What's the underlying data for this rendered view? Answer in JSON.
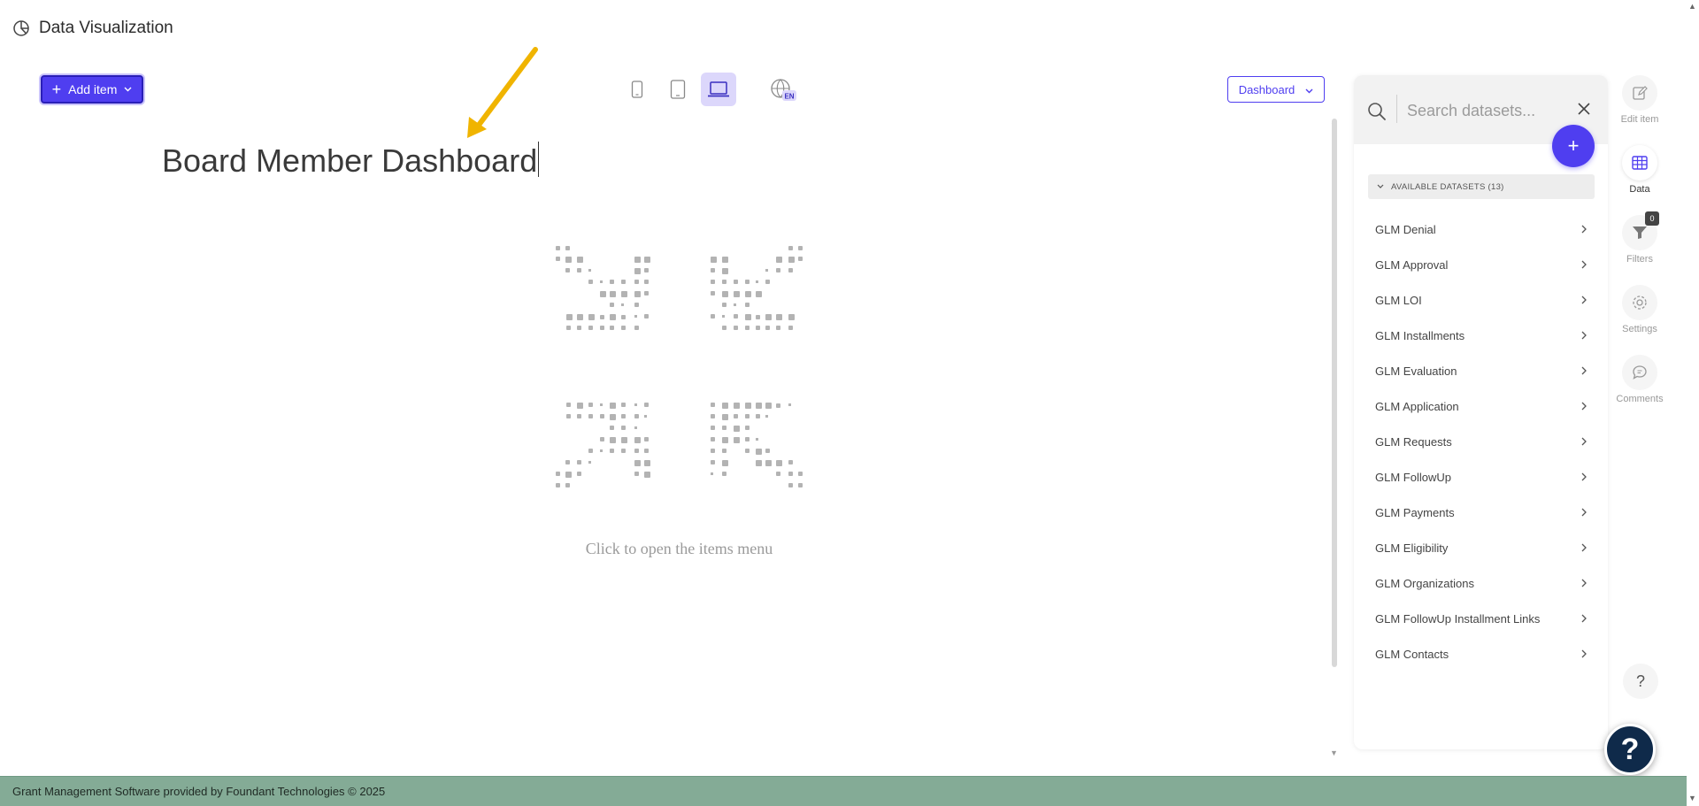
{
  "app": {
    "title": "Data Visualization"
  },
  "toolbar": {
    "add_item_label": "Add item",
    "dashboard_select_label": "Dashboard",
    "language_badge": "EN"
  },
  "dashboard": {
    "title": "Board Member Dashboard",
    "empty_hint": "Click to open the items menu"
  },
  "data_panel": {
    "search_placeholder": "Search datasets...",
    "datasets_header": "AVAILABLE DATASETS (13)",
    "datasets": [
      "GLM Denial",
      "GLM Approval",
      "GLM LOI",
      "GLM Installments",
      "GLM Evaluation",
      "GLM Application",
      "GLM Requests",
      "GLM FollowUp",
      "GLM Payments",
      "GLM Eligibility",
      "GLM Organizations",
      "GLM FollowUp Installment Links",
      "GLM Contacts"
    ]
  },
  "rail": {
    "edit_item": "Edit item",
    "data": "Data",
    "filters": "Filters",
    "filters_count": "0",
    "settings": "Settings",
    "comments": "Comments"
  },
  "help": {
    "small": "?",
    "big": "?"
  },
  "footer": {
    "text": "Grant Management Software provided by Foundant Technologies © 2025"
  },
  "colors": {
    "accent": "#4f3ef0",
    "footer": "#84ab96",
    "help": "#0f2a4a",
    "arrow": "#f0b400"
  }
}
